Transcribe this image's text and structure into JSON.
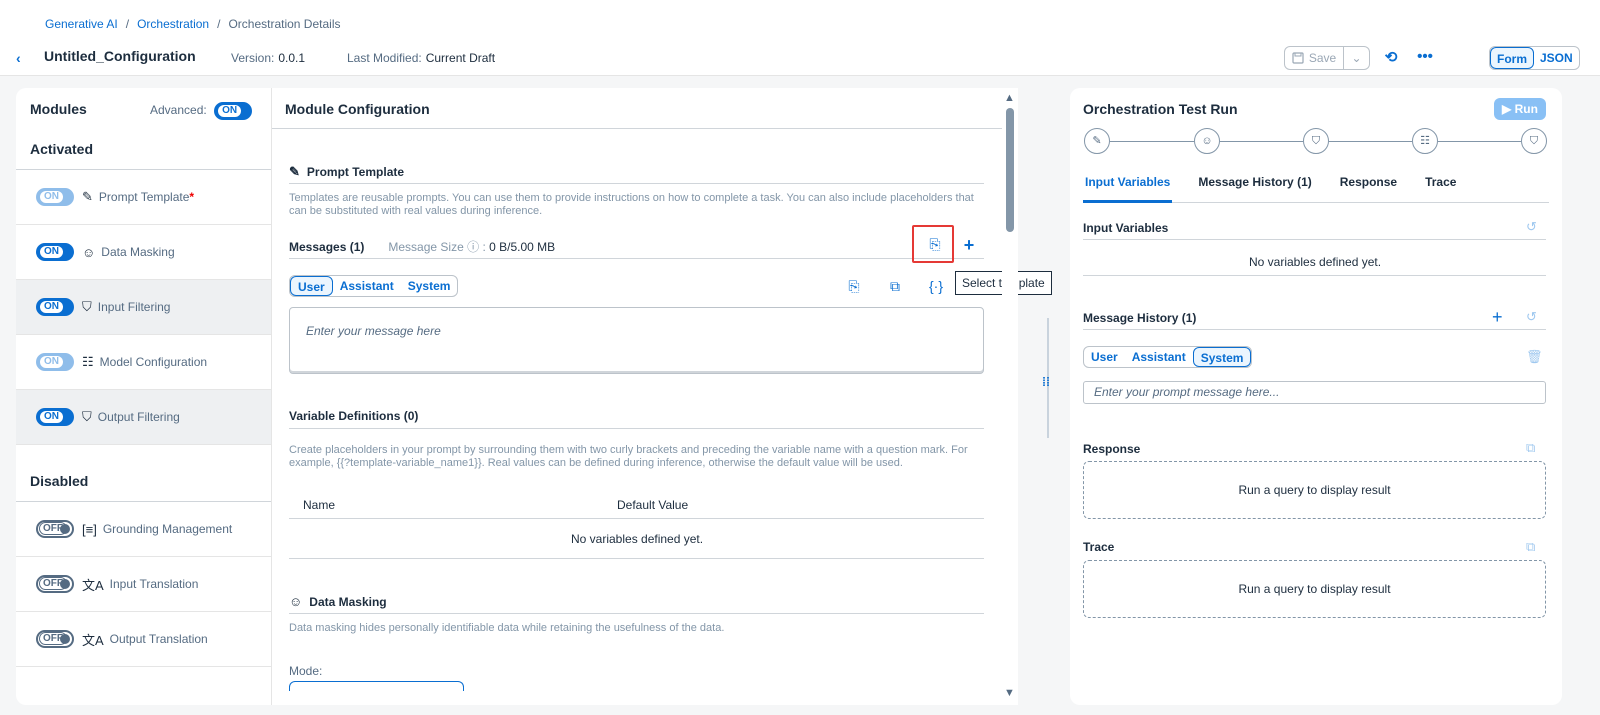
{
  "breadcrumb": [
    "Generative AI",
    "Orchestration",
    "Orchestration Details"
  ],
  "header": {
    "title": "Untitled_Configuration",
    "version_label": "Version:",
    "version_value": "0.0.1",
    "modified_label": "Last Modified:",
    "modified_value": "Current Draft",
    "save_label": "Save",
    "form_label": "Form",
    "json_label": "JSON"
  },
  "modules": {
    "title": "Modules",
    "advanced_label": "Advanced:",
    "advanced_state": "ON",
    "activated_heading": "Activated",
    "disabled_heading": "Disabled",
    "activated": [
      {
        "label": "Prompt Template",
        "state": "ON",
        "required": "*"
      },
      {
        "label": "Data Masking",
        "state": "ON"
      },
      {
        "label": "Input Filtering",
        "state": "ON"
      },
      {
        "label": "Model Configuration",
        "state": "ON"
      },
      {
        "label": "Output Filtering",
        "state": "ON"
      }
    ],
    "disabled": [
      {
        "label": "Grounding Management",
        "state": "OFF"
      },
      {
        "label": "Input Translation",
        "state": "OFF"
      },
      {
        "label": "Output Translation",
        "state": "OFF"
      }
    ]
  },
  "config": {
    "title": "Module Configuration",
    "prompt_template": {
      "heading": "Prompt Template",
      "description": "Templates are reusable prompts. You can use them to provide instructions on how to complete a task. You can also include placeholders that can be substituted with real values during inference.",
      "messages_label": "Messages (1)",
      "message_size_label": "Message Size",
      "message_size_value": "0 B/5.00 MB",
      "roles": [
        "User",
        "Assistant",
        "System"
      ],
      "message_placeholder": "Enter your message here",
      "tooltip": "Select template"
    },
    "variables": {
      "heading": "Variable Definitions (0)",
      "description": "Create placeholders in your prompt by surrounding them with two curly brackets and preceding the variable name with a question mark. For example, {{?template-variable_name1}}. Real values can be defined during inference, otherwise the default value will be used.",
      "col_name": "Name",
      "col_default": "Default Value",
      "empty": "No variables defined yet."
    },
    "data_masking": {
      "heading": "Data Masking",
      "description": "Data masking hides personally identifiable data while retaining the usefulness of the data.",
      "mode_label": "Mode:"
    }
  },
  "test_run": {
    "title": "Orchestration Test Run",
    "run_label": "Run",
    "tabs": [
      "Input Variables",
      "Message History (1)",
      "Response",
      "Trace"
    ],
    "input_variables_heading": "Input Variables",
    "input_variables_empty": "No variables defined yet.",
    "message_history_heading": "Message History (1)",
    "roles": [
      "User",
      "Assistant",
      "System"
    ],
    "prompt_placeholder": "Enter your prompt message here...",
    "response_heading": "Response",
    "response_empty": "Run a query to display result",
    "trace_heading": "Trace",
    "trace_empty": "Run a query to display result"
  }
}
